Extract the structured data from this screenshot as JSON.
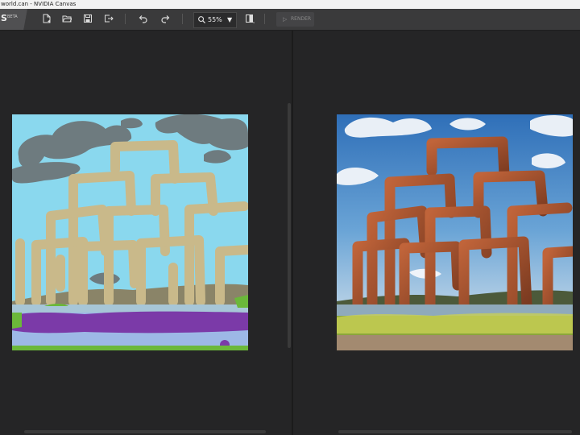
{
  "window": {
    "title": "world.can - NVIDIA Canvas"
  },
  "app": {
    "logo": "S",
    "badge": "BETA"
  },
  "toolbar": {
    "buttons": [
      {
        "name": "new-file-button",
        "icon": "new-file-icon"
      },
      {
        "name": "open-folder-button",
        "icon": "folder-icon"
      },
      {
        "name": "save-button",
        "icon": "save-icon"
      },
      {
        "name": "export-button",
        "icon": "export-icon"
      },
      {
        "name": "undo-button",
        "icon": "undo-icon"
      },
      {
        "name": "redo-button",
        "icon": "redo-icon"
      },
      {
        "name": "compare-view-button",
        "icon": "split-view-icon"
      }
    ],
    "zoom": {
      "value": "55%",
      "arrow": "▼"
    },
    "render": {
      "label": "RENDER",
      "icon": "▷",
      "enabled": false
    }
  },
  "colors": {
    "background": "#252526",
    "toolbar": "#3a3a3b",
    "sky_paint": "#8ad8ee",
    "cloud_paint": "#6e7b7f",
    "arch_paint": "#c9b98a",
    "flower_paint": "#7b3aa8",
    "water_paint": "#9db8e6",
    "grass_paint": "#6bb83a"
  }
}
